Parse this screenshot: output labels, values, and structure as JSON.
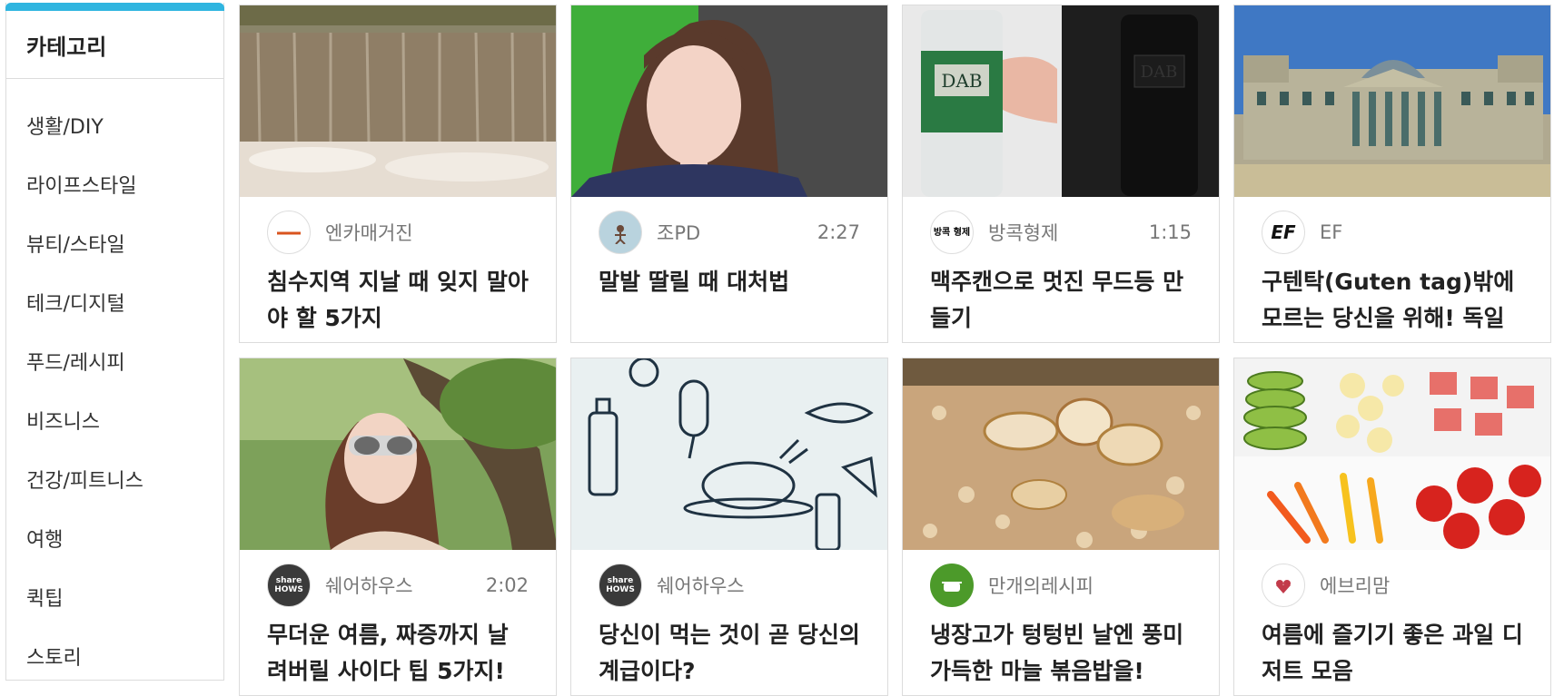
{
  "sidebar": {
    "header": "카테고리",
    "items": [
      {
        "label": "생활/DIY"
      },
      {
        "label": "라이프스타일"
      },
      {
        "label": "뷰티/스타일"
      },
      {
        "label": "테크/디지털"
      },
      {
        "label": "푸드/레시피"
      },
      {
        "label": "비즈니스"
      },
      {
        "label": "건강/피트니스"
      },
      {
        "label": "여행"
      },
      {
        "label": "퀵팁"
      },
      {
        "label": "스토리"
      }
    ]
  },
  "cards": [
    {
      "channel": "엔카매거진",
      "duration": "",
      "title": "침수지역 지날 때 잊지 말아야 할 5가지",
      "thumb": "waterfall",
      "avatar": "encar-logo-icon"
    },
    {
      "channel": "조PD",
      "duration": "2:27",
      "title": "말발 딸릴 때 대처법",
      "thumb": "woman-portrait",
      "avatar": "jopd-avatar-icon"
    },
    {
      "channel": "방콕형제",
      "duration": "1:15",
      "title": "맥주캔으로 멋진 무드등 만들기",
      "thumb": "beer-cans",
      "avatar": "bangkok-brothers-logo-icon"
    },
    {
      "channel": "EF",
      "duration": "",
      "title": "구텐탁(Guten tag)밖에 모르는 당신을 위해! 독일",
      "thumb": "reichstag",
      "avatar": "ef-logo-icon"
    },
    {
      "channel": "쉐어하우스",
      "duration": "2:02",
      "title": "무더운 여름, 짜증까지 날려버릴 사이다 팁 5가지!",
      "thumb": "woman-sunglasses",
      "avatar": "sharehows-logo-icon"
    },
    {
      "channel": "쉐어하우스",
      "duration": "",
      "title": "당신이 먹는 것이 곧 당신의 계급이다?",
      "thumb": "food-doodle",
      "avatar": "sharehows-logo-icon"
    },
    {
      "channel": "만개의레시피",
      "duration": "",
      "title": "냉장고가 텅텅빈 날엔 풍미 가득한 마늘 볶음밥을!",
      "thumb": "garlic-rice",
      "avatar": "10000-recipe-logo-icon"
    },
    {
      "channel": "에브리맘",
      "duration": "",
      "title": "여름에 즐기기 좋은 과일 디저트 모음",
      "thumb": "fruit-plate",
      "avatar": "everymom-logo-icon"
    }
  ],
  "avatar_text": {
    "sharehows": "share HOWS",
    "ef": "EF",
    "bangkok": "방콕 형제"
  },
  "colors": {
    "accent": "#2fb5e0",
    "text_primary": "#222222",
    "text_secondary": "#777777",
    "border": "#dcdcdc"
  }
}
